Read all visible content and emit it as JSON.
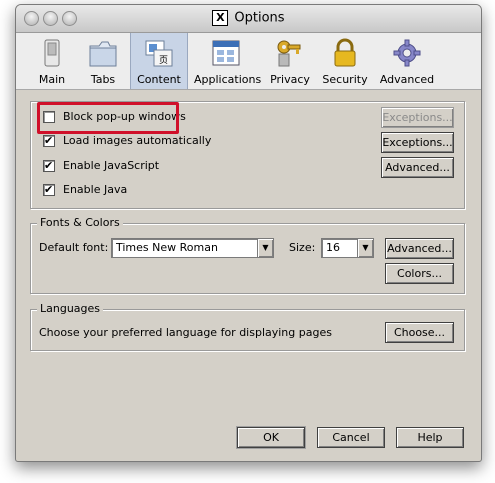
{
  "window": {
    "title": "Options",
    "app_logo": "X"
  },
  "toolbar": [
    {
      "label": "Main",
      "icon": "switch-icon"
    },
    {
      "label": "Tabs",
      "icon": "folder-tabs-icon"
    },
    {
      "label": "Content",
      "icon": "content-page-icon",
      "active": true
    },
    {
      "label": "Applications",
      "icon": "applications-window-icon"
    },
    {
      "label": "Privacy",
      "icon": "key-icon"
    },
    {
      "label": "Security",
      "icon": "lock-icon"
    },
    {
      "label": "Advanced",
      "icon": "gear-icon"
    }
  ],
  "content": {
    "block_popups": {
      "label": "Block pop-up windows",
      "checked": false
    },
    "load_images": {
      "label": "Load images automatically",
      "checked": true
    },
    "enable_js": {
      "label": "Enable JavaScript",
      "checked": true
    },
    "enable_java": {
      "label": "Enable Java",
      "checked": true
    },
    "exceptions_disabled": "Exceptions...",
    "exceptions": "Exceptions...",
    "advanced": "Advanced..."
  },
  "fonts": {
    "legend": "Fonts & Colors",
    "default_font_label": "Default font:",
    "default_font_value": "Times New Roman",
    "size_label": "Size:",
    "size_value": "16",
    "advanced": "Advanced...",
    "colors": "Colors..."
  },
  "languages": {
    "legend": "Languages",
    "description": "Choose your preferred language for displaying pages",
    "choose": "Choose..."
  },
  "footer": {
    "ok": "OK",
    "cancel": "Cancel",
    "help": "Help"
  },
  "colors": {
    "highlight": "#d0102a",
    "active_tab": "#c8d4e6",
    "window_bg": "#d4d0c8"
  }
}
